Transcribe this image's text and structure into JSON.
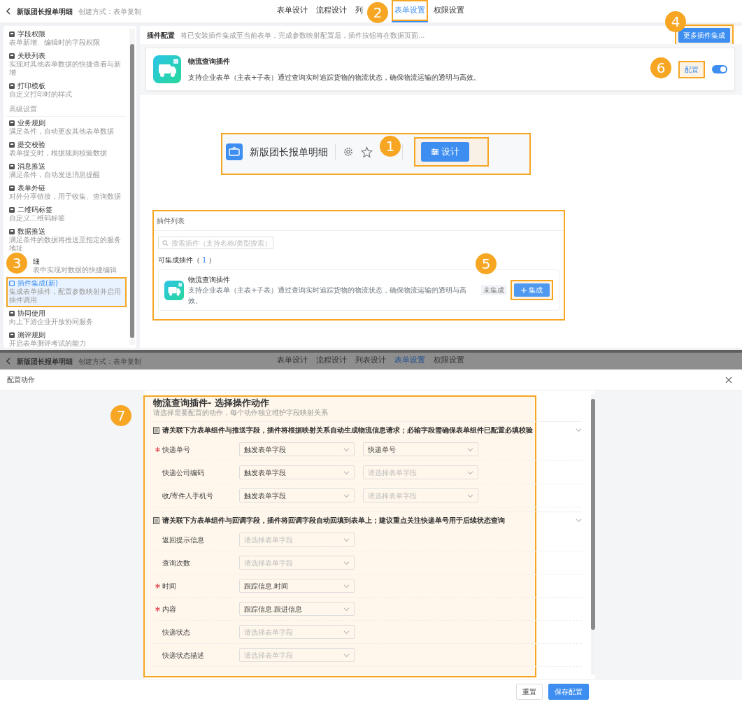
{
  "top": {
    "header": {
      "title": "新版团长报单明细",
      "subtitle": "创建方式：表单复制",
      "tabs": [
        {
          "label": "表单设计",
          "selected": false,
          "highlighted": false
        },
        {
          "label": "流程设计",
          "selected": false,
          "highlighted": false
        },
        {
          "label": "列",
          "selected": false,
          "highlighted": false
        },
        {
          "label": "表单设置",
          "selected": true,
          "highlighted": true
        },
        {
          "label": "权限设置",
          "selected": false,
          "highlighted": false
        }
      ]
    },
    "sidebar": {
      "items": [
        {
          "kind": "item",
          "title": "字段权限",
          "description": "表单新增、编辑时的字段权限",
          "selected": false,
          "highlighted": false
        },
        {
          "kind": "item",
          "title": "关联列表",
          "description": "实现对其他表单数据的快捷查看与新增",
          "selected": false,
          "highlighted": false
        },
        {
          "kind": "item",
          "title": "打印模板",
          "description": "自定义打印时的样式",
          "selected": false,
          "highlighted": false
        },
        {
          "kind": "section",
          "title": "高级设置"
        },
        {
          "kind": "item",
          "title": "业务规则",
          "description": "满足条件，自动更改其他表单数据",
          "selected": false,
          "highlighted": false
        },
        {
          "kind": "item",
          "title": "提交校验",
          "description": "表单提交时，根据规则校验数据",
          "selected": false,
          "highlighted": false
        },
        {
          "kind": "item",
          "title": "消息推送",
          "description": "满足条件，自动发送消息提醒",
          "selected": false,
          "highlighted": false
        },
        {
          "kind": "item",
          "title": "表单外链",
          "description": "对外分享链接，用于收集、查询数据",
          "selected": false,
          "highlighted": false
        },
        {
          "kind": "item",
          "title": "二维码标签",
          "description": "自定义二维码标签",
          "selected": false,
          "highlighted": false
        },
        {
          "kind": "item",
          "title": "数据推送",
          "description": "满足条件的数据将推送至指定的服务地址",
          "selected": false,
          "highlighted": false
        },
        {
          "kind": "partial",
          "title": "细",
          "description": "表中实现对数据的快捷编辑",
          "selected": false,
          "highlighted": false
        },
        {
          "kind": "item",
          "title": "插件集成(新)",
          "description": "集成表单插件，配置参数映射并启用插件调用",
          "selected": true,
          "highlighted": true
        },
        {
          "kind": "item",
          "title": "协同使用",
          "description": "向上下游企业开放协同服务",
          "selected": false,
          "highlighted": false
        },
        {
          "kind": "item",
          "title": "测评规则",
          "description": "开启表单测评考试的能力",
          "selected": false,
          "highlighted": false
        }
      ]
    },
    "config": {
      "title": "插件配置",
      "hint": "将已安装插件集成至当前表单，完成参数映射配置后，插件按钮将在数据页面...",
      "button": {
        "label": "更多插件集成",
        "highlighted": true
      }
    },
    "plugin": {
      "name": "物流查询插件",
      "description": "支持企业表单（主表+子表）通过查询实时追踪货物的物流状态，确保物流运输的透明与高效。",
      "config_link": {
        "label": "配置",
        "highlighted": true
      },
      "enabled": true
    },
    "design_bar": {
      "title": "新版团长报单明细",
      "button": {
        "label": "设计",
        "highlighted": true
      }
    },
    "plugin_list": {
      "title": "插件列表",
      "search": {
        "placeholder": "搜索插件（支持名称/类型搜索）"
      },
      "count_prefix": "可集成插件（",
      "count": "1",
      "count_suffix": "）",
      "items": [
        {
          "name": "物流查询插件",
          "description": "支持企业表单（主表+子表）通过查询实时追踪货物的物流状态，确保物流运输的透明与高效。",
          "status": "未集成",
          "button": {
            "label": "集成",
            "highlighted": true
          }
        }
      ]
    }
  },
  "dialog": {
    "header": {
      "title": "新版团长报单明细",
      "subtitle": "创建方式：表单复制",
      "tabs": [
        {
          "label": "表单设计",
          "selected": false
        },
        {
          "label": "流程设计",
          "selected": false
        },
        {
          "label": "列表设计",
          "selected": false
        },
        {
          "label": "表单设置",
          "selected": true
        },
        {
          "label": "权限设置",
          "selected": false
        }
      ]
    },
    "title": "配置动作",
    "panel": {
      "highlighted": true,
      "title": "物流查询插件- 选择操作动作",
      "subtitle": "请选择需要配置的动作，每个动作独立维护字段映射关系",
      "sections": [
        {
          "heading": "请关联下方表单组件与推送字段，插件将根据映射关系自动生成物流信息请求；必输字段需确保表单组件已配置必填校验",
          "expanded": true,
          "rows": [
            {
              "label": "快递单号",
              "required": true,
              "fields": [
                {
                  "value": "触发表单字段"
                },
                {
                  "value": "快递单号"
                }
              ]
            },
            {
              "label": "快递公司编码",
              "required": false,
              "fields": [
                {
                  "value": "触发表单字段"
                },
                {
                  "placeholder": "请选择表单字段"
                }
              ]
            },
            {
              "label": "收/寄件人手机号",
              "required": false,
              "fields": [
                {
                  "value": "触发表单字段"
                },
                {
                  "placeholder": "请选择表单字段"
                }
              ]
            }
          ]
        },
        {
          "heading": "请关联下方表单组件与回调字段，插件将回调字段自动回填到表单上；建议重点关注快递单号用于后续状态查询",
          "expanded": true,
          "rows": [
            {
              "label": "返回提示信息",
              "required": false,
              "fields": [
                {
                  "placeholder": "请选择表单字段"
                }
              ]
            },
            {
              "label": "查询次数",
              "required": false,
              "fields": [
                {
                  "placeholder": "请选择表单字段"
                }
              ]
            },
            {
              "label": "时间",
              "required": true,
              "fields": [
                {
                  "value": "跟踪信息.时间"
                }
              ]
            },
            {
              "label": "内容",
              "required": true,
              "fields": [
                {
                  "value": "跟踪信息.跟进信息"
                }
              ]
            },
            {
              "label": "快递状态",
              "required": false,
              "fields": [
                {
                  "placeholder": "请选择表单字段"
                }
              ]
            },
            {
              "label": "快递状态描述",
              "required": false,
              "fields": [
                {
                  "placeholder": "请选择表单字段"
                }
              ]
            }
          ]
        }
      ]
    },
    "buttons": [
      {
        "label": "重置",
        "kind": "secondary"
      },
      {
        "label": "保存配置",
        "kind": "primary"
      }
    ]
  },
  "callouts": [
    "1",
    "2",
    "3",
    "4",
    "5",
    "6",
    "7"
  ]
}
